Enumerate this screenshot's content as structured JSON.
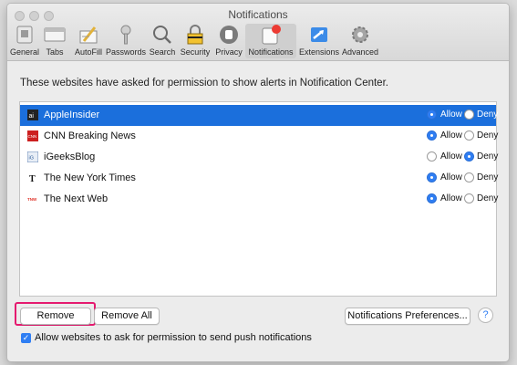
{
  "window": {
    "title": "Notifications"
  },
  "toolbar": {
    "items": [
      {
        "label": "General"
      },
      {
        "label": "Tabs"
      },
      {
        "label": "AutoFill"
      },
      {
        "label": "Passwords"
      },
      {
        "label": "Search"
      },
      {
        "label": "Security"
      },
      {
        "label": "Privacy"
      },
      {
        "label": "Notifications"
      },
      {
        "label": "Extensions"
      },
      {
        "label": "Advanced"
      }
    ],
    "active": "Notifications"
  },
  "main": {
    "intro": "These websites have asked for permission to show alerts in Notification Center.",
    "allow_label": "Allow",
    "deny_label": "Deny",
    "sites": [
      {
        "name": "AppleInsider",
        "choice": "allow",
        "icon_text": "ai",
        "selected": true
      },
      {
        "name": "CNN Breaking News",
        "choice": "allow",
        "icon_text": "CNN",
        "selected": false
      },
      {
        "name": "iGeeksBlog",
        "choice": "deny",
        "icon_text": "iG",
        "selected": false
      },
      {
        "name": "The New York Times",
        "choice": "allow",
        "icon_text": "T",
        "selected": false
      },
      {
        "name": "The Next Web",
        "choice": "allow",
        "icon_text": "TNW",
        "selected": false
      }
    ]
  },
  "buttons": {
    "remove": "Remove",
    "remove_all": "Remove All",
    "notif_prefs": "Notifications Preferences...",
    "help": "?"
  },
  "checkbox": {
    "label": "Allow websites to ask for permission to send push notifications",
    "checked": true
  },
  "colors": {
    "accent": "#2f7ef3",
    "selection": "#1b6fdc",
    "highlight": "#e51a6f"
  }
}
